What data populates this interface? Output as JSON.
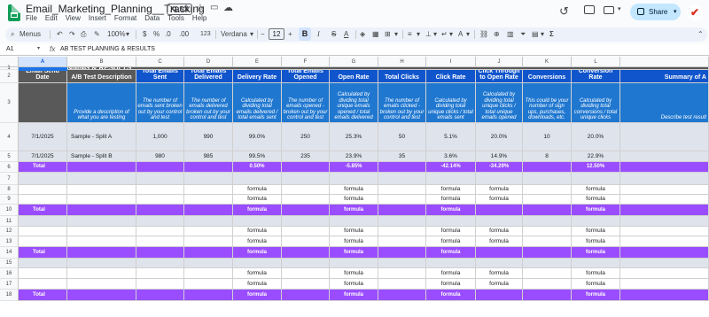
{
  "window": {
    "title": "Email_Marketing_Planning__Tracking",
    "file_badge": "XLSX",
    "menu": [
      "File",
      "Edit",
      "View",
      "Insert",
      "Format",
      "Data",
      "Tools",
      "Help"
    ],
    "share_label": "Share",
    "avatar_glyph": "✔"
  },
  "toolbar": {
    "menus_label": "Menus",
    "zoom": "100%",
    "currency": "$",
    "percent": "%",
    "decimal_dec": ".0",
    "decimal_inc": ".00",
    "number_format": "123",
    "font": "Verdana",
    "font_size": "12",
    "bold": "B",
    "italic": "I",
    "strike": "S",
    "text_color": "A"
  },
  "formula_bar": {
    "name_box": "A1",
    "fx": "fx",
    "content": "AB TEST PLANNING & RESULTS"
  },
  "columns": [
    "A",
    "B",
    "C",
    "D",
    "E",
    "F",
    "G",
    "H",
    "I",
    "J",
    "K",
    "L"
  ],
  "selected_column": "A",
  "rows": [
    "1",
    "2",
    "3",
    "4",
    "5",
    "6",
    "7",
    "8",
    "9",
    "10",
    "11",
    "12",
    "13",
    "14",
    "15",
    "16",
    "17",
    "18"
  ],
  "sheet": {
    "title": "AB TEST PLANNING & RESULTS",
    "headers": [
      "Email Send Date",
      "A/B Test Description",
      "Total Emails Sent",
      "Total Emails Delivered",
      "Delivery Rate",
      "Total Emails Opened",
      "Open Rate",
      "Total Clicks",
      "Click Rate",
      "Click Through to Open Rate",
      "Conversions",
      "Conversion Rate",
      "Summary of A"
    ],
    "desc": [
      "",
      "Provide a description of what you are testing",
      "The number of emails sent broken out by your control and test",
      "The number of emails delivered broken out by your control and test",
      "Calculated by dividing total emails delivered / total emails sent",
      "The number of emails opened - broken out by your control and test",
      "Calculated by dividing total unique emails opened / total emails delivered",
      "The number of emails clicked - broken out by your control and test",
      "Calculated by dividing total unique clicks / total emails sent",
      "Calculated by dividing total unique clicks / total unique emails opened",
      "This could be your number of sign ups, purchases, downloads, etc.",
      "Calculated by dividing total conversions / total unique clicks",
      "Describe test result"
    ],
    "data_rows": [
      [
        "7/1/2025",
        "Sample - Split A",
        "1,000",
        "990",
        "99.0%",
        "250",
        "25.3%",
        "50",
        "5.1%",
        "20.0%",
        "10",
        "20.0%",
        ""
      ],
      [
        "7/1/2025",
        "Sample - Split B",
        "980",
        "985",
        "99.5%",
        "235",
        "23.9%",
        "35",
        "3.6%",
        "14.9%",
        "8",
        "22.9%",
        ""
      ]
    ],
    "total_row": [
      "Total",
      "",
      "",
      "",
      "0.50%",
      "",
      "-5.85%",
      "",
      "-42.14%",
      "-34.29%",
      "",
      "12.50%",
      ""
    ],
    "formula_word": "formula",
    "total_label": "Total"
  },
  "colors": {
    "header_dark": "#595959",
    "header_blue": "#1155cc",
    "desc_blue": "#1f77d0",
    "total_purple": "#9a4dff",
    "input_gray": "#dfe3ec"
  }
}
